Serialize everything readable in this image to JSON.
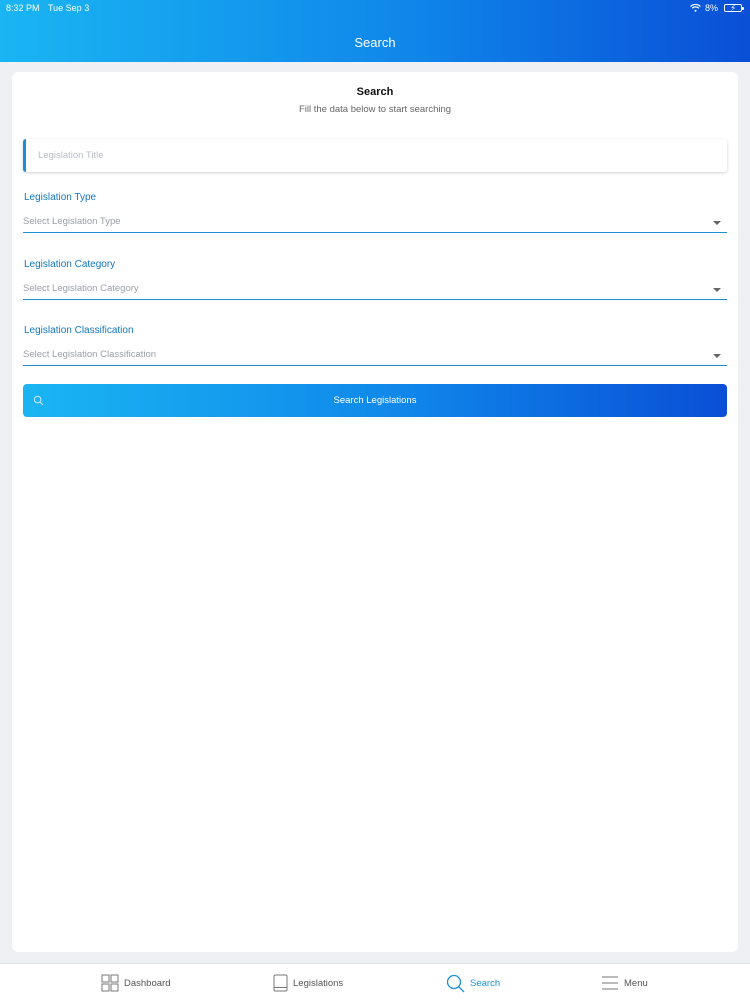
{
  "status_bar": {
    "time": "8:32 PM",
    "date": "Tue Sep 3",
    "battery": "8%"
  },
  "header": {
    "title": "Search"
  },
  "form": {
    "title": "Search",
    "subtitle": "Fill the data below to start searching",
    "title_input": {
      "placeholder": "Legislation Title",
      "value": ""
    },
    "type": {
      "label": "Legislation Type",
      "placeholder": "Select Legislation Type"
    },
    "category": {
      "label": "Legislation Category",
      "placeholder": "Select Legislation Category"
    },
    "classification": {
      "label": "Legislation Classification",
      "placeholder": "Select Legislation Classification"
    },
    "search_button": {
      "label": "Search Legislations",
      "icon": "search-icon"
    }
  },
  "tabbar": {
    "items": [
      {
        "label": "Dashboard",
        "icon": "grid-icon",
        "active": false
      },
      {
        "label": "Legislations",
        "icon": "book-icon",
        "active": false
      },
      {
        "label": "Search",
        "icon": "search-icon",
        "active": true
      },
      {
        "label": "Menu",
        "icon": "menu-icon",
        "active": false
      }
    ]
  },
  "colors": {
    "accent": "#1a8fd2",
    "gradient_start": "#1ab5f2",
    "gradient_end": "#0a4fd6"
  }
}
